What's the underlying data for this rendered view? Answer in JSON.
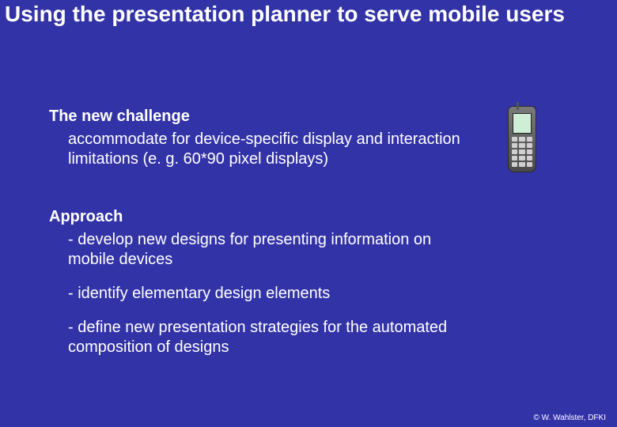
{
  "title": "Using the presentation planner to serve mobile users",
  "challenge": {
    "heading": "The new challenge",
    "text": "accommodate for device-specific display and interaction limitations (e. g. 60*90 pixel displays)"
  },
  "approach": {
    "heading": "Approach",
    "bullets": [
      "- develop new designs for presenting information on mobile devices",
      "- identify elementary design elements",
      "- define new presentation strategies for the automated composition of designs"
    ]
  },
  "footer": "© W. Wahlster, DFKI",
  "image_alt": "mobile-phone"
}
